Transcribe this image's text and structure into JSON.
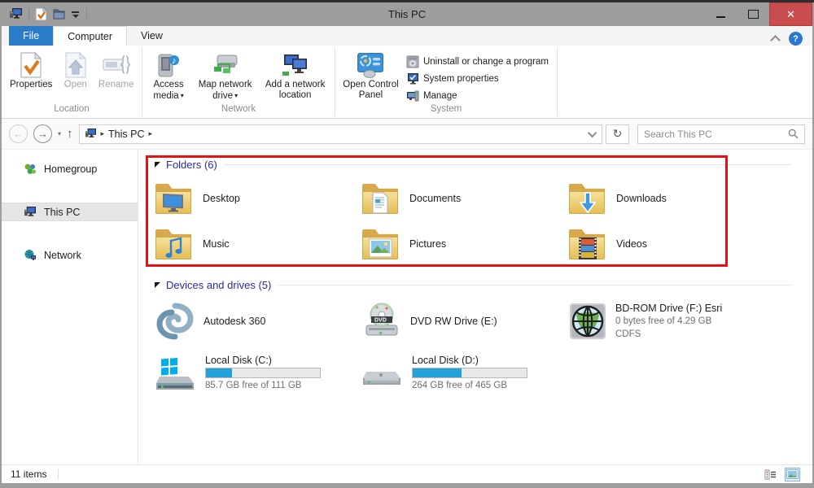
{
  "window": {
    "title": "This PC"
  },
  "tabs": {
    "file": "File",
    "computer": "Computer",
    "view": "View"
  },
  "ribbon": {
    "location": {
      "label": "Location",
      "properties": "Properties",
      "open": "Open",
      "rename": "Rename"
    },
    "network": {
      "label": "Network",
      "access_media": "Access media",
      "map_drive": "Map network drive",
      "add_location": "Add a network location"
    },
    "system": {
      "label": "System",
      "control_panel": "Open Control Panel",
      "uninstall": "Uninstall or change a program",
      "sys_props": "System properties",
      "manage": "Manage"
    }
  },
  "navbar": {
    "address_root": "This PC",
    "search_placeholder": "Search This PC"
  },
  "sidebar": {
    "homegroup": "Homegroup",
    "this_pc": "This PC",
    "network": "Network"
  },
  "sections": {
    "folders": {
      "header": "Folders (6)",
      "items": [
        {
          "name": "Desktop"
        },
        {
          "name": "Documents"
        },
        {
          "name": "Downloads"
        },
        {
          "name": "Music"
        },
        {
          "name": "Pictures"
        },
        {
          "name": "Videos"
        }
      ]
    },
    "devices": {
      "header": "Devices and drives (5)",
      "autodesk": {
        "name": "Autodesk 360"
      },
      "dvd": {
        "name": "DVD RW Drive (E:)"
      },
      "bdrom": {
        "name": "BD-ROM Drive (F:) Esri",
        "free": "0 bytes free of 4.29 GB",
        "fs": "CDFS"
      },
      "disk_c": {
        "name": "Local Disk (C:)",
        "free": "85.7 GB free of 111 GB",
        "used_percent": 23
      },
      "disk_d": {
        "name": "Local Disk (D:)",
        "free": "264 GB free of 465 GB",
        "used_percent": 43
      }
    }
  },
  "statusbar": {
    "items": "11 items"
  }
}
